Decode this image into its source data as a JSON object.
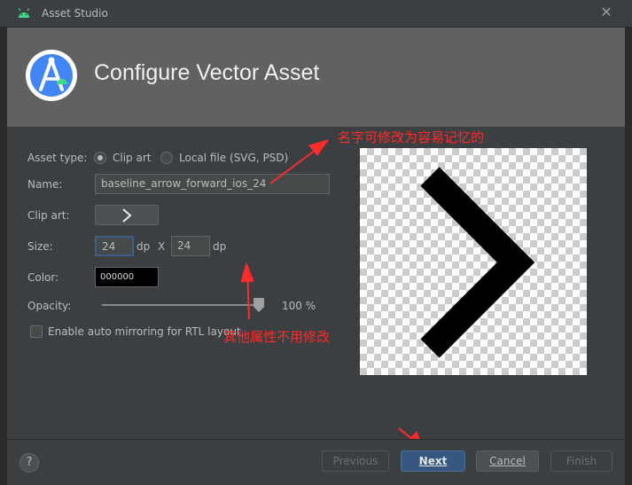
{
  "window": {
    "title": "Asset Studio",
    "close_icon": "close-icon"
  },
  "header": {
    "title": "Configure Vector Asset"
  },
  "form": {
    "asset_type_label": "Asset type:",
    "asset_type_options": [
      {
        "label": "Clip art",
        "selected": true
      },
      {
        "label": "Local file (SVG, PSD)",
        "selected": false
      }
    ],
    "name_label": "Name:",
    "name_value": "baseline_arrow_forward_ios_24",
    "clip_art_label": "Clip art:",
    "clip_art_icon": "chevron-right-icon",
    "size_label": "Size:",
    "width_value": "24",
    "height_value": "24",
    "unit": "dp",
    "size_separator": "X",
    "color_label": "Color:",
    "color_value": "000000",
    "opacity_label": "Opacity:",
    "opacity_value": "100 %",
    "opacity_fraction": 1.0,
    "mirror_label": "Enable auto mirroring for RTL layout",
    "mirror_checked": false
  },
  "annotations": {
    "name_note": "名字可修改为容易记忆的",
    "other_note": "其他属性不用修改"
  },
  "footer": {
    "help_label": "?",
    "previous_label": "Previous",
    "next_label": "Next",
    "cancel_label": "Cancel",
    "finish_label": "Finish"
  },
  "colors": {
    "accent": "#365880",
    "annotation": "#ff2a2a",
    "android_green": "#3ddc84"
  }
}
